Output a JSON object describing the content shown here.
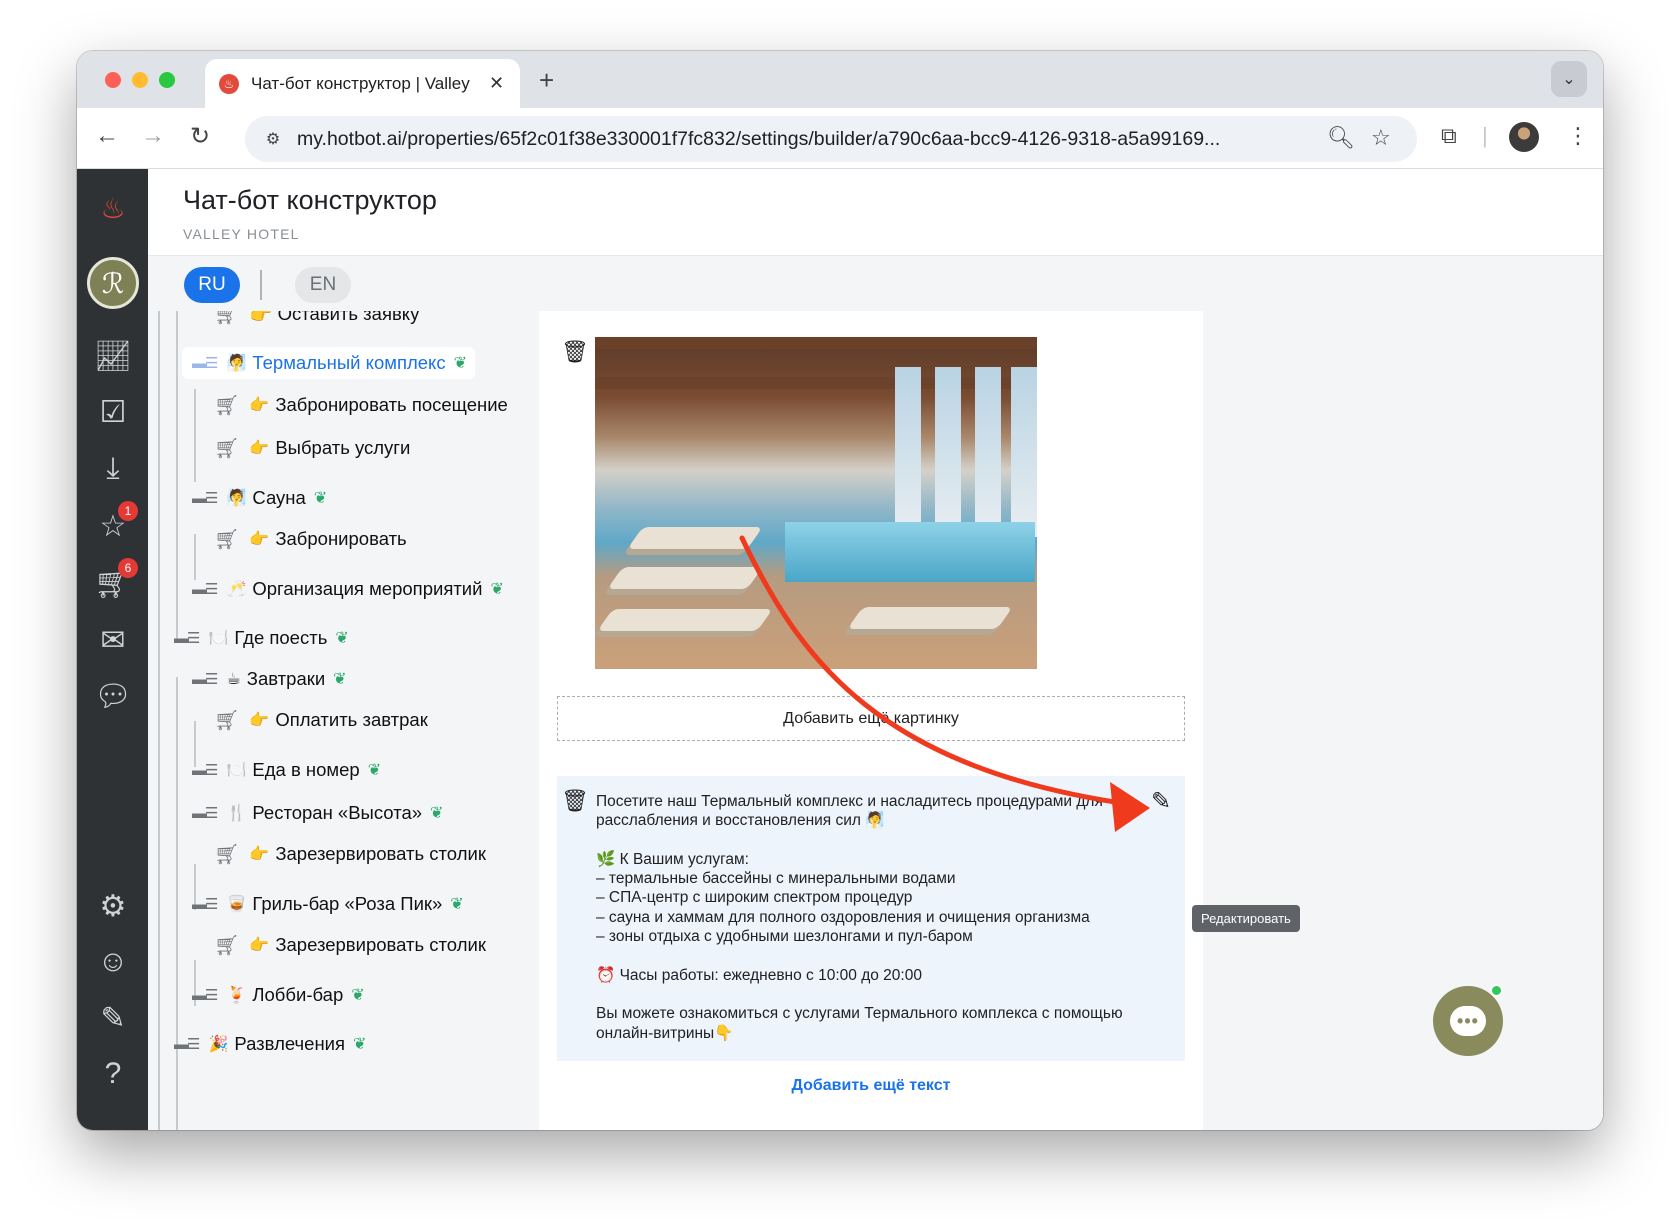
{
  "browser": {
    "tab_title": "Чат-бот конструктор | Valley",
    "tab_favicon": "hotbot-flame-icon",
    "new_tab": "+",
    "url": "my.hotbot.ai/properties/65f2c01f38e330001f7fc832/settings/builder/a790c6aa-bcc9-4126-9318-a5a99169..."
  },
  "header": {
    "title": "Чат-бот конструктор",
    "subtitle": "VALLEY HOTEL"
  },
  "languages": {
    "ru": "RU",
    "en": "EN",
    "selected": "RU"
  },
  "sidebar": {
    "badges": {
      "reviews": "1",
      "orders": "6"
    }
  },
  "tree": {
    "items": [
      {
        "label": "👉 Оставить заявку",
        "type": "action",
        "partial": true
      },
      {
        "label": "Термальный комплекс",
        "emoji": "🧖",
        "type": "menu",
        "active": true
      },
      {
        "label": "Забронировать посещение",
        "emoji": "👉",
        "type": "action"
      },
      {
        "label": "Выбрать услуги",
        "emoji": "👉",
        "type": "action"
      },
      {
        "label": "Сауна",
        "emoji": "🧖",
        "type": "menu"
      },
      {
        "label": "Забронировать",
        "emoji": "👉",
        "type": "action"
      },
      {
        "label": "Организация мероприятий",
        "emoji": "🥂",
        "type": "menu"
      },
      {
        "label": "Где поесть",
        "emoji": "🍽️",
        "type": "menu"
      },
      {
        "label": "Завтраки",
        "emoji": "☕",
        "type": "menu"
      },
      {
        "label": "Оплатить завтрак",
        "emoji": "👉",
        "type": "action"
      },
      {
        "label": "Еда в номер",
        "emoji": "🍽️",
        "type": "menu"
      },
      {
        "label": "Ресторан «Высота»",
        "emoji": "🍴",
        "type": "menu"
      },
      {
        "label": "Зарезервировать столик",
        "emoji": "👉",
        "type": "action"
      },
      {
        "label": "Гриль-бар «Роза Пик»",
        "emoji": "🥃",
        "type": "menu"
      },
      {
        "label": "Зарезервировать столик",
        "emoji": "👉",
        "type": "action"
      },
      {
        "label": "Лобби-бар",
        "emoji": "🍹",
        "type": "menu"
      },
      {
        "label": "Развлечения",
        "emoji": "🎉",
        "type": "menu"
      }
    ]
  },
  "content": {
    "add_image_label": "Добавить ещё картинку",
    "text_lines": [
      "Посетите наш Термальный комплекс и насладитесь процедурами для",
      "расслабления и восстановления сил 🧖",
      "",
      "🌿 К Вашим услугам:",
      "– термальные бассейны с минеральными водами",
      "– СПА-центр с широким спектром процедур",
      "– сауна и хаммам для полного оздоровления и очищения организма",
      "– зоны отдыха с удобными шезлонгами и пул-баром",
      "",
      "⏰ Часы работы: ежедневно с 10:00 до 20:00",
      "",
      "Вы можете ознакомиться с услугами Термального комплекса с помощью",
      "онлайн-витрины👇"
    ],
    "edit_tooltip": "Редактировать",
    "add_text_label": "Добавить ещё текст"
  },
  "colors": {
    "accent": "#1a73e8",
    "sidebar_bg": "#2f3235",
    "annotation_arrow": "#f03a1e",
    "chat_button": "#8a8b5d"
  }
}
